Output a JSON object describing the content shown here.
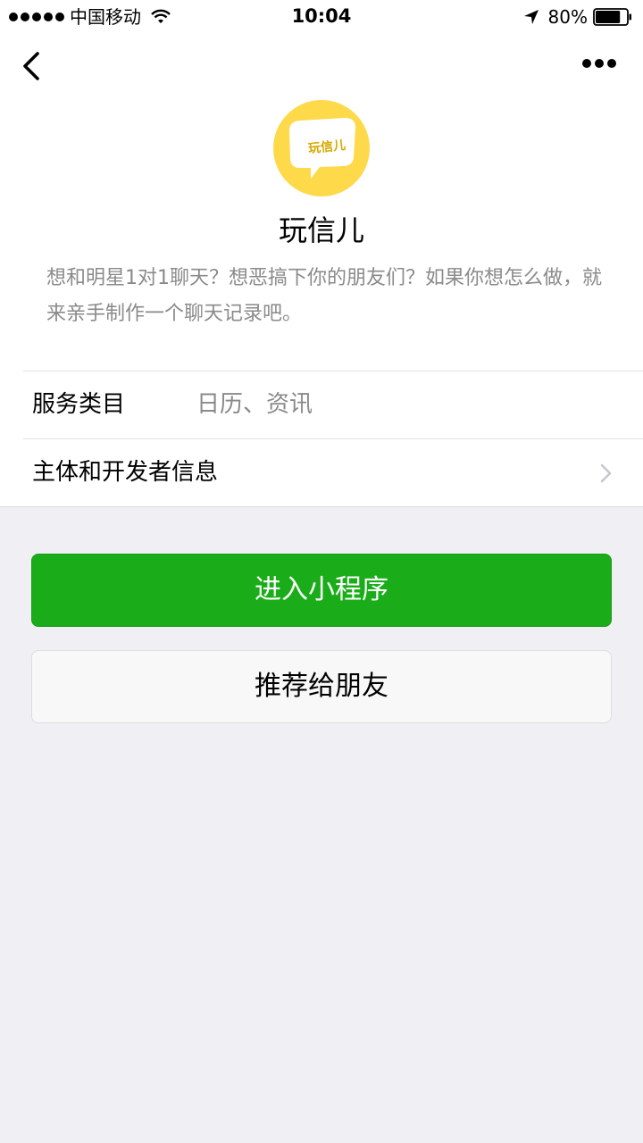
{
  "status_bar": {
    "carrier": "中国移动",
    "time": "10:04",
    "battery_percent": "80%",
    "battery_level": 0.8,
    "icons": [
      "signal-dots-icon",
      "wifi-icon",
      "location-arrow-icon",
      "battery-icon"
    ]
  },
  "nav": {
    "back_icon": "chevron-left-icon",
    "more_icon": "more-dots-icon"
  },
  "app": {
    "logo_text": "玩信儿",
    "logo_color": "#fed94a",
    "name": "玩信儿",
    "description": "想和明星1对1聊天？想恶搞下你的朋友们？如果你想怎么做，就来亲手制作一个聊天记录吧。"
  },
  "info": {
    "service_label": "服务类目",
    "service_value": "日历、资讯",
    "developer_label": "主体和开发者信息"
  },
  "actions": {
    "enter_label": "进入小程序",
    "enter_color": "#1aad19",
    "share_label": "推荐给朋友"
  }
}
